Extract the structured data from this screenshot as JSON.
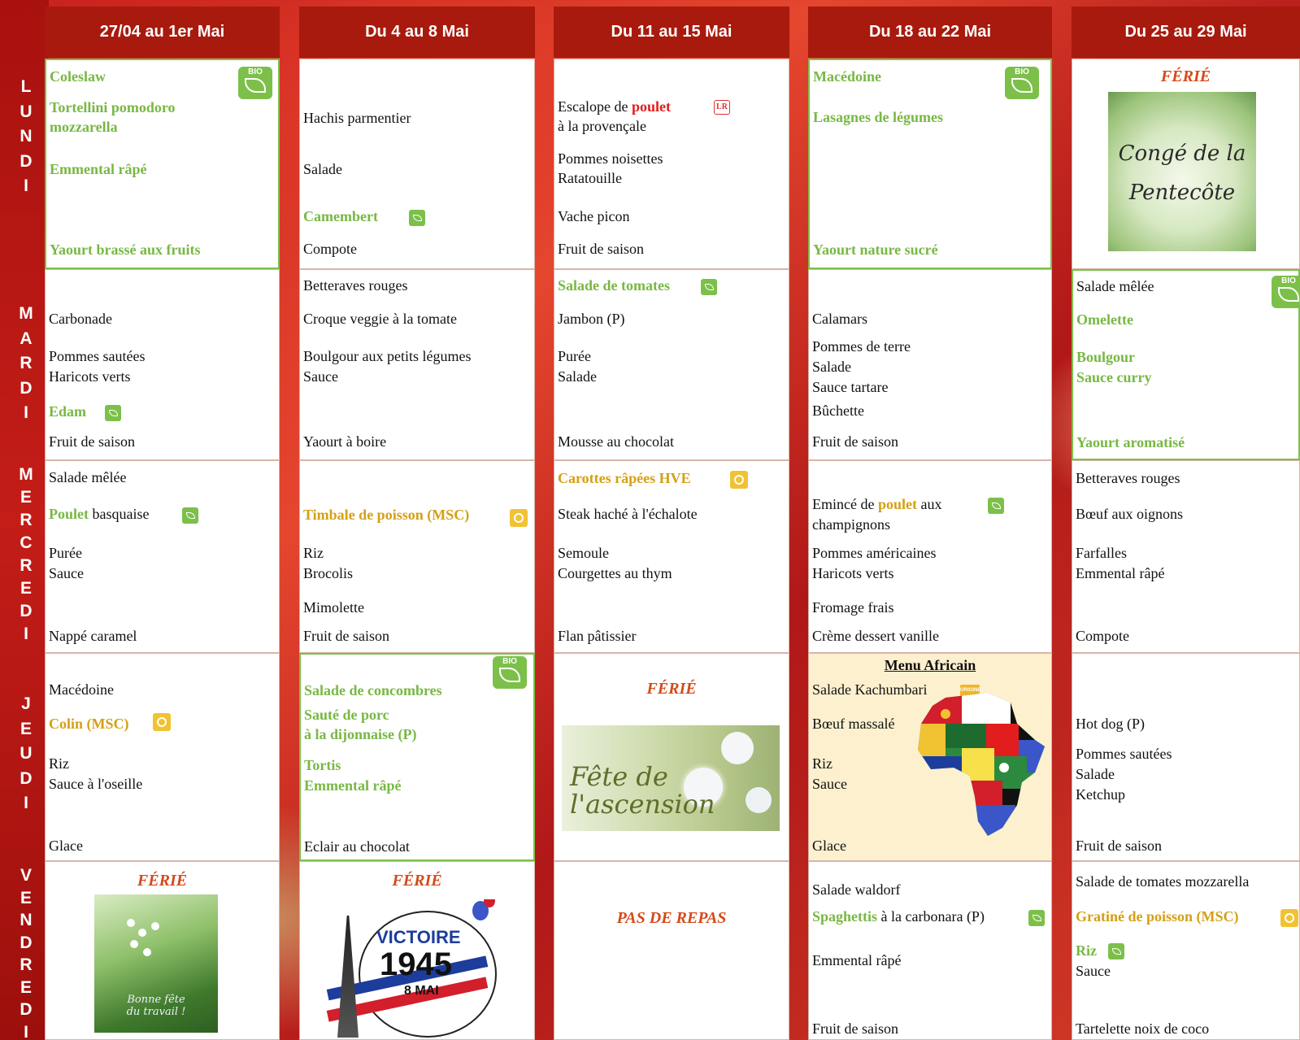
{
  "colors": {
    "header_bg": "#a81a0d",
    "bio_green": "#78b843",
    "label_gold": "#d4a014",
    "ferie_orange": "#d44a1a",
    "poulet_red": "#e11d1d"
  },
  "days": {
    "lundi": [
      "L",
      "U",
      "N",
      "D",
      "I"
    ],
    "mardi": [
      "M",
      "A",
      "R",
      "D",
      "I"
    ],
    "mercredi": [
      "M",
      "E",
      "R",
      "C",
      "R",
      "E",
      "D",
      "I"
    ],
    "jeudi": [
      "J",
      "E",
      "U",
      "D",
      "I"
    ],
    "vendredi": [
      "V",
      "E",
      "N",
      "D",
      "R",
      "E",
      "D",
      "I"
    ]
  },
  "weeks": [
    "27/04 au 1er Mai",
    "Du 4 au 8 Mai",
    "Du 11 au 15 Mai",
    "Du 18 au 22 Mai",
    "Du 25 au 29 Mai"
  ],
  "icons": {
    "bio": "BIO",
    "label_rouge": "LR",
    "origine_france": "ORIGINE"
  },
  "ferie": "FÉRIÉ",
  "pas_de_repas": "PAS DE REPAS",
  "menu_africain": "Menu Africain",
  "images": {
    "pentecote_l1": "Congé de la",
    "pentecote_l2": "Pentecôte",
    "ascension_l1": "Fête de",
    "ascension_l2": "l'ascension",
    "travail_l1": "Bonne fête",
    "travail_l2": "du travail !",
    "victoire_l1": "VICTOIRE",
    "victoire_l2": "1945",
    "victoire_l3": "8 MAI"
  },
  "menu": {
    "w1": {
      "lundi": [
        "Coleslaw",
        "Tortellini pomodoro",
        "mozzarella",
        "Emmental râpé",
        "Yaourt brassé aux fruits"
      ],
      "mardi": [
        "Carbonade",
        "Pommes sautées",
        "Haricots verts",
        "Edam",
        "Fruit de saison"
      ],
      "mercredi": [
        "Salade mêlée",
        "Poulet",
        " basquaise",
        "Purée",
        "Sauce",
        "Nappé caramel"
      ],
      "jeudi": [
        "Macédoine",
        "Colin (MSC)",
        "Riz",
        "Sauce à l'oseille",
        "Glace"
      ]
    },
    "w2": {
      "lundi": [
        "Hachis parmentier",
        "Salade",
        "Camembert",
        "Compote"
      ],
      "mardi": [
        "Betteraves rouges",
        "Croque veggie à la tomate",
        "Boulgour aux petits légumes",
        "Sauce",
        "Yaourt à boire"
      ],
      "mercredi": [
        "Timbale de poisson (MSC)",
        "Riz",
        "Brocolis",
        "Mimolette",
        "Fruit de saison"
      ],
      "jeudi": [
        "Salade de concombres",
        "Sauté de porc",
        "à la dijonnaise (P)",
        "Tortis",
        "Emmental râpé",
        "Eclair au chocolat"
      ]
    },
    "w3": {
      "lundi": [
        "Escalope de ",
        "poulet",
        "à la provençale",
        "Pommes noisettes",
        "Ratatouille",
        "Vache picon",
        "Fruit de saison"
      ],
      "mardi": [
        "Salade de tomates",
        "Jambon (P)",
        "Purée",
        "Salade",
        "Mousse au chocolat"
      ],
      "mercredi": [
        "Carottes râpées HVE",
        "Steak haché à l'échalote",
        "Semoule",
        "Courgettes au thym",
        "Flan pâtissier"
      ]
    },
    "w4": {
      "lundi": [
        "Macédoine",
        "Lasagnes de légumes",
        "Yaourt nature sucré"
      ],
      "mardi": [
        "Calamars",
        "Pommes de terre",
        "Salade",
        "Sauce tartare",
        "Bûchette",
        "Fruit de saison"
      ],
      "mercredi": [
        "Emincé de ",
        "poulet",
        " aux",
        "champignons",
        "Pommes américaines",
        "Haricots verts",
        "Fromage frais",
        "Crème dessert vanille"
      ],
      "jeudi": [
        "Salade Kachumbari",
        "Bœuf massalé",
        "Riz",
        "Sauce",
        "Glace"
      ],
      "vendredi": [
        "Salade waldorf",
        "Spaghettis",
        " à la carbonara (P)",
        "Emmental râpé",
        "Fruit de saison"
      ]
    },
    "w5": {
      "mardi": [
        "Salade mêlée",
        "Omelette",
        "Boulgour",
        "Sauce curry",
        "Yaourt aromatisé"
      ],
      "mercredi": [
        "Betteraves rouges",
        "Bœuf aux oignons",
        "Farfalles",
        "Emmental râpé",
        "Compote"
      ],
      "jeudi": [
        "Hot dog (P)",
        "Pommes sautées",
        "Salade",
        "Ketchup",
        "Fruit de saison"
      ],
      "vendredi": [
        "Salade de tomates mozzarella",
        "Gratiné de poisson (MSC)",
        "Riz",
        "Sauce",
        "Tartelette noix de coco"
      ]
    }
  }
}
